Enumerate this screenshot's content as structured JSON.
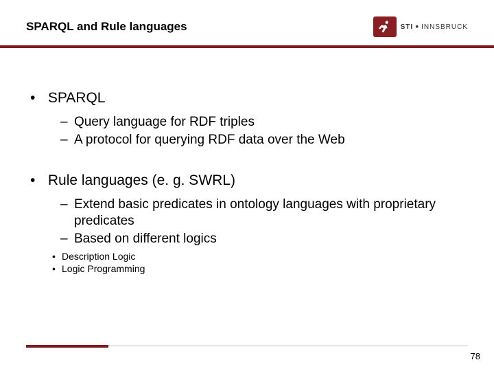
{
  "header": {
    "title": "SPARQL and Rule languages",
    "logo": {
      "sti": "STI",
      "dot": "•",
      "rest": "INNSBRUCK"
    }
  },
  "bullets": {
    "0": {
      "text": "SPARQL",
      "sub": {
        "0": "Query language for RDF triples",
        "1": "A protocol for querying RDF data over the Web"
      }
    },
    "1": {
      "text": "Rule languages (e. g. SWRL)",
      "sub": {
        "0": "Extend basic predicates in ontology languages with proprietary predicates",
        "1": "Based on different logics"
      },
      "subsub": {
        "0": "Description Logic",
        "1": "Logic Programming"
      }
    }
  },
  "page_number": "78"
}
